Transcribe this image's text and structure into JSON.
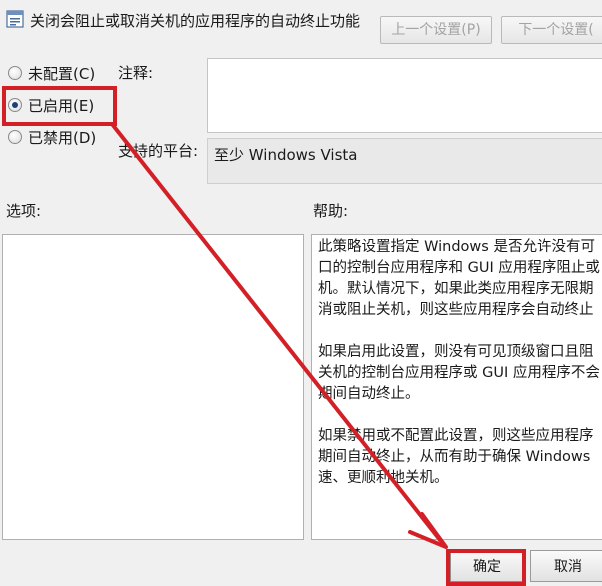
{
  "window": {
    "policy_title": "关闭会阻止或取消关机的应用程序的自动终止功能",
    "icon": "policy-setting-icon"
  },
  "nav": {
    "prev_label": "上一个设置(P)",
    "next_label": "下一个设置("
  },
  "state": {
    "options": [
      {
        "label": "未配置(C)",
        "checked": false
      },
      {
        "label": "已启用(E)",
        "checked": true
      },
      {
        "label": "已禁用(D)",
        "checked": false
      }
    ]
  },
  "comment": {
    "label": "注释:",
    "value": ""
  },
  "platform": {
    "label": "支持的平台:",
    "value": "至少 Windows Vista"
  },
  "options_section": {
    "label": "选项:"
  },
  "help": {
    "label": "帮助:",
    "lines": [
      "此策略设置指定 Windows 是否允许没有可",
      "口的控制台应用程序和 GUI 应用程序阻止或",
      "机。默认情况下，如果此类应用程序无限期",
      "消或阻止关机，则这些应用程序会自动终止",
      "如果启用此设置，则没有可见顶级窗口且阻",
      "关机的控制台应用程序或 GUI 应用程序不会",
      "期间自动终止。",
      "如果禁用或不配置此设置，则这些应用程序",
      "期间自动终止，从而有助于确保 Windows",
      "速、更顺利地关机。"
    ]
  },
  "footer": {
    "ok_label": "确定",
    "cancel_label": "取消"
  },
  "annotation": {
    "color": "#d32027"
  }
}
